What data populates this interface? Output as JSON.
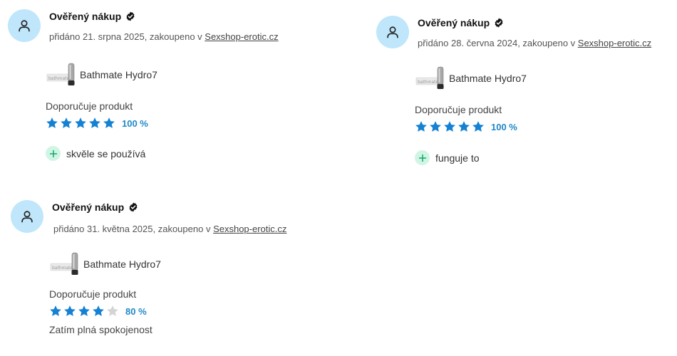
{
  "reviews": [
    {
      "verified_label": "Ověřený nákup",
      "meta_prefix": "přidáno 21. srpna 2025,  zakoupeno v ",
      "shop_name": "Sexshop-erotic.cz",
      "product_name": "Bathmate Hydro7",
      "thumb_label": "bathmate",
      "recommend_label": "Doporučuje produkt",
      "rating_percent_text": "100 %",
      "rating_stars": 5,
      "pro_text": "skvěle se používá"
    },
    {
      "verified_label": "Ověřený nákup",
      "meta_prefix": "přidáno 28. června 2024, zakoupeno v ",
      "shop_name": "Sexshop-erotic.cz",
      "product_name": "Bathmate Hydro7",
      "thumb_label": "bathmate",
      "recommend_label": "Doporučuje produkt",
      "rating_percent_text": "100 %",
      "rating_stars": 5,
      "pro_text": "funguje to"
    },
    {
      "verified_label": "Ověřený nákup",
      "meta_prefix": "přidáno 31. května 2025, zakoupeno v ",
      "shop_name": "Sexshop-erotic.cz",
      "product_name": "Bathmate Hydro7",
      "thumb_label": "bathmate",
      "recommend_label": "Doporučuje produkt",
      "rating_percent_text": "80 %",
      "rating_stars": 4,
      "comment": "Zatím plná spokojenost"
    }
  ],
  "colors": {
    "star_filled": "#1581d3",
    "star_empty": "#d4d4d4",
    "avatar_bg": "#bfe6fb",
    "pro_icon_bg": "#d1f5e5",
    "pro_icon_fg": "#14a86a",
    "percent_text": "#1e88c8"
  },
  "icons": {
    "avatar": "user-outline-icon",
    "verified": "check-circle-icon",
    "pro": "plus-icon",
    "star": "star-icon"
  }
}
